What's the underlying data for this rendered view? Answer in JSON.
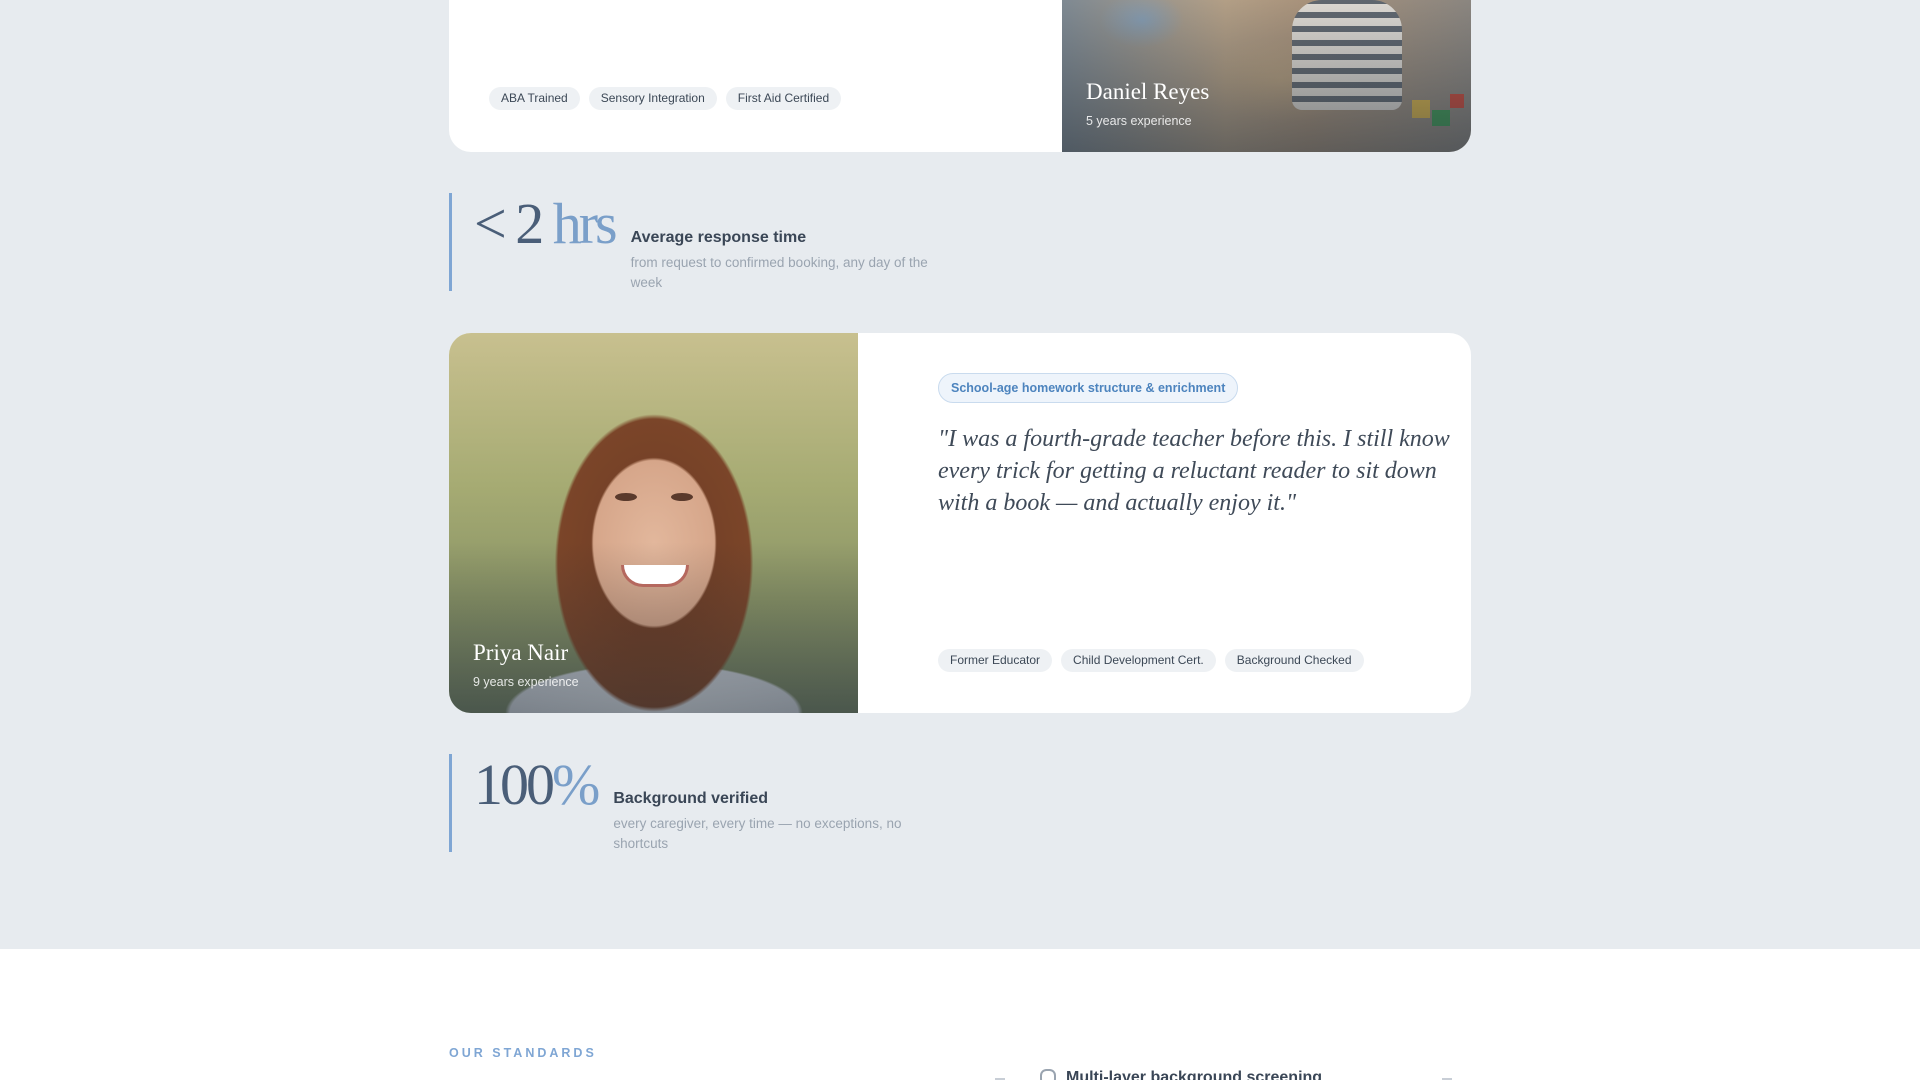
{
  "caregivers": {
    "daniel": {
      "name": "Daniel Reyes",
      "experience": "5 years experience",
      "tags": [
        "ABA Trained",
        "Sensory Integration",
        "First Aid Certified"
      ]
    },
    "priya": {
      "name": "Priya Nair",
      "experience": "9 years experience",
      "specialty": "School-age homework structure & enrichment",
      "quote": "\"I was a fourth-grade teacher before this. I still know every trick for getting a reluctant reader to sit down with a book — and actually enjoy it.\"",
      "tags": [
        "Former Educator",
        "Child Development Cert.",
        "Background Checked"
      ]
    }
  },
  "stats": {
    "response": {
      "value_prefix": "< 2 ",
      "value_unit": "hrs",
      "title": "Average response time",
      "subtitle": "from request to confirmed booking, any day of the week"
    },
    "verified": {
      "value_prefix": "100",
      "value_unit": "%",
      "title": "Background verified",
      "subtitle": "every caregiver, every time — no exceptions, no shortcuts"
    }
  },
  "standards": {
    "eyebrow": "OUR STANDARDS",
    "first_item": "Multi-layer background screening"
  },
  "colors": {
    "accent": "#7fa6d4",
    "page_bg": "#e7ebef",
    "card_bg": "#ffffff"
  },
  "icons": {
    "standard_item": "shield-icon"
  }
}
